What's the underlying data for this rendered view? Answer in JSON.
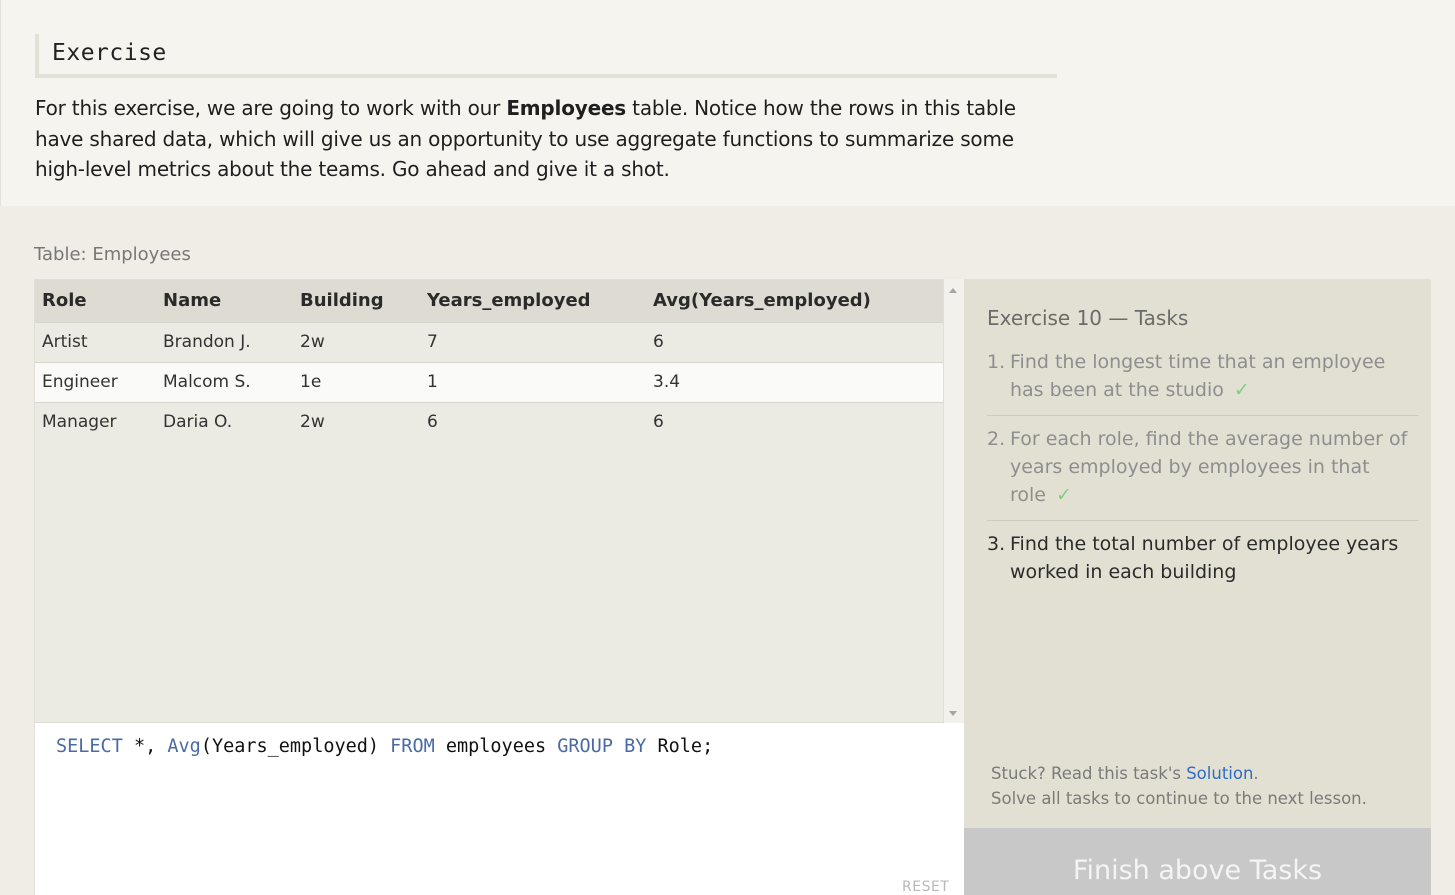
{
  "intro": {
    "heading": "Exercise",
    "text_before": "For this exercise, we are going to work with our ",
    "text_bold": "Employees",
    "text_after": " table. Notice how the rows in this table have shared data, which will give us an opportunity to use aggregate functions to summarize some high-level metrics about the teams. Go ahead and give it a shot."
  },
  "table": {
    "caption": "Table: Employees",
    "columns": [
      "Role",
      "Name",
      "Building",
      "Years_employed",
      "Avg(Years_employed)"
    ],
    "rows": [
      [
        "Artist",
        "Brandon J.",
        "2w",
        "7",
        "6"
      ],
      [
        "Engineer",
        "Malcom S.",
        "1e",
        "1",
        "3.4"
      ],
      [
        "Manager",
        "Daria O.",
        "2w",
        "6",
        "6"
      ]
    ]
  },
  "editor": {
    "query_tokens": [
      {
        "text": "SELECT",
        "kw": true
      },
      {
        "text": " *, ",
        "kw": false
      },
      {
        "text": "Avg",
        "kw": true
      },
      {
        "text": "(Years_employed) ",
        "kw": false
      },
      {
        "text": "FROM",
        "kw": true
      },
      {
        "text": " employees ",
        "kw": false
      },
      {
        "text": "GROUP BY",
        "kw": true
      },
      {
        "text": " Role;",
        "kw": false
      }
    ],
    "reset_label": "RESET"
  },
  "tasks": {
    "title": "Exercise 10 — Tasks",
    "items": [
      {
        "num": "1.",
        "text": "Find the longest time that an employee has been at the studio",
        "done": true,
        "check": "✓"
      },
      {
        "num": "2.",
        "text": "For each role, find the average number of years employed by employees in that role",
        "done": true,
        "check": "✓"
      },
      {
        "num": "3.",
        "text": "Find the total number of employee years worked in each building",
        "done": false,
        "check": ""
      }
    ],
    "stuck_prefix": "Stuck? Read this task's ",
    "solution_link": "Solution",
    "stuck_suffix": ".",
    "continue_text": "Solve all tasks to continue to the next lesson.",
    "finish_label": "Finish above Tasks"
  }
}
